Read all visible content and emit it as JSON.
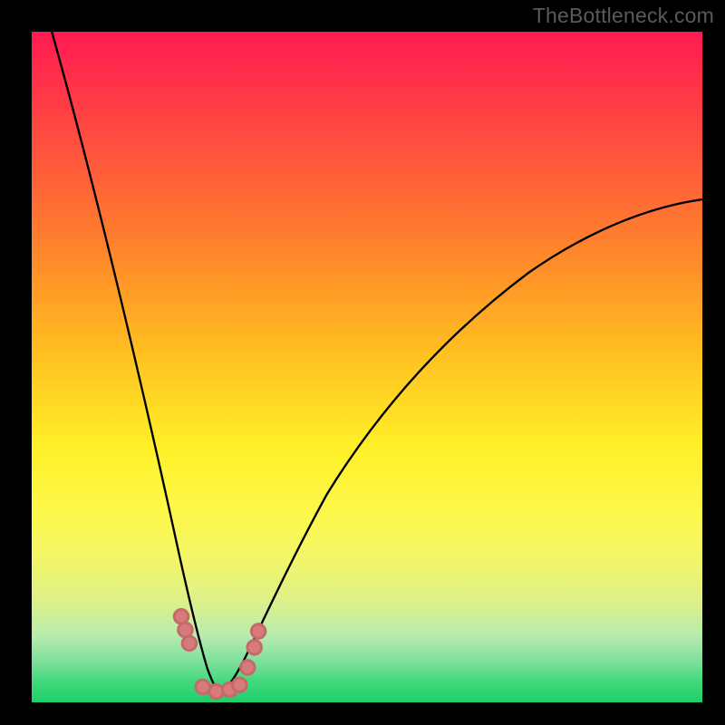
{
  "watermark": "TheBottleneck.com",
  "chart_data": {
    "type": "line",
    "title": "",
    "xlabel": "",
    "ylabel": "",
    "xlim": [
      0,
      100
    ],
    "ylim": [
      0,
      100
    ],
    "note": "Axis units unlabeled; values below are pixel-space normalised 0–100 read from curve geometry (0=left/bottom, 100=right/top). Minimum (bottleneck) occurs near x≈28. Salmon dots cluster around the trough.",
    "series": [
      {
        "name": "curve-left",
        "x": [
          3,
          6,
          9,
          12,
          15,
          18,
          21,
          23,
          24.5,
          25.8,
          26.8,
          27.5,
          28
        ],
        "values": [
          100,
          88,
          76,
          64,
          52,
          40,
          28,
          18,
          12,
          7,
          4,
          2.2,
          1.5
        ]
      },
      {
        "name": "curve-right",
        "x": [
          28,
          29,
          30.5,
          33,
          37,
          42,
          48,
          55,
          63,
          72,
          82,
          92,
          100
        ],
        "values": [
          1.5,
          2.5,
          5,
          10,
          18,
          28,
          38,
          47,
          55,
          62,
          68,
          72.5,
          75
        ]
      },
      {
        "name": "trough-dots",
        "x": [
          22.3,
          22.9,
          23.5,
          25.5,
          27.5,
          29.5,
          31,
          32.2,
          33.2,
          33.8
        ],
        "values": [
          12.8,
          10.8,
          8.8,
          2.3,
          1.6,
          1.9,
          2.6,
          5.2,
          8.2,
          10.6
        ]
      }
    ]
  }
}
